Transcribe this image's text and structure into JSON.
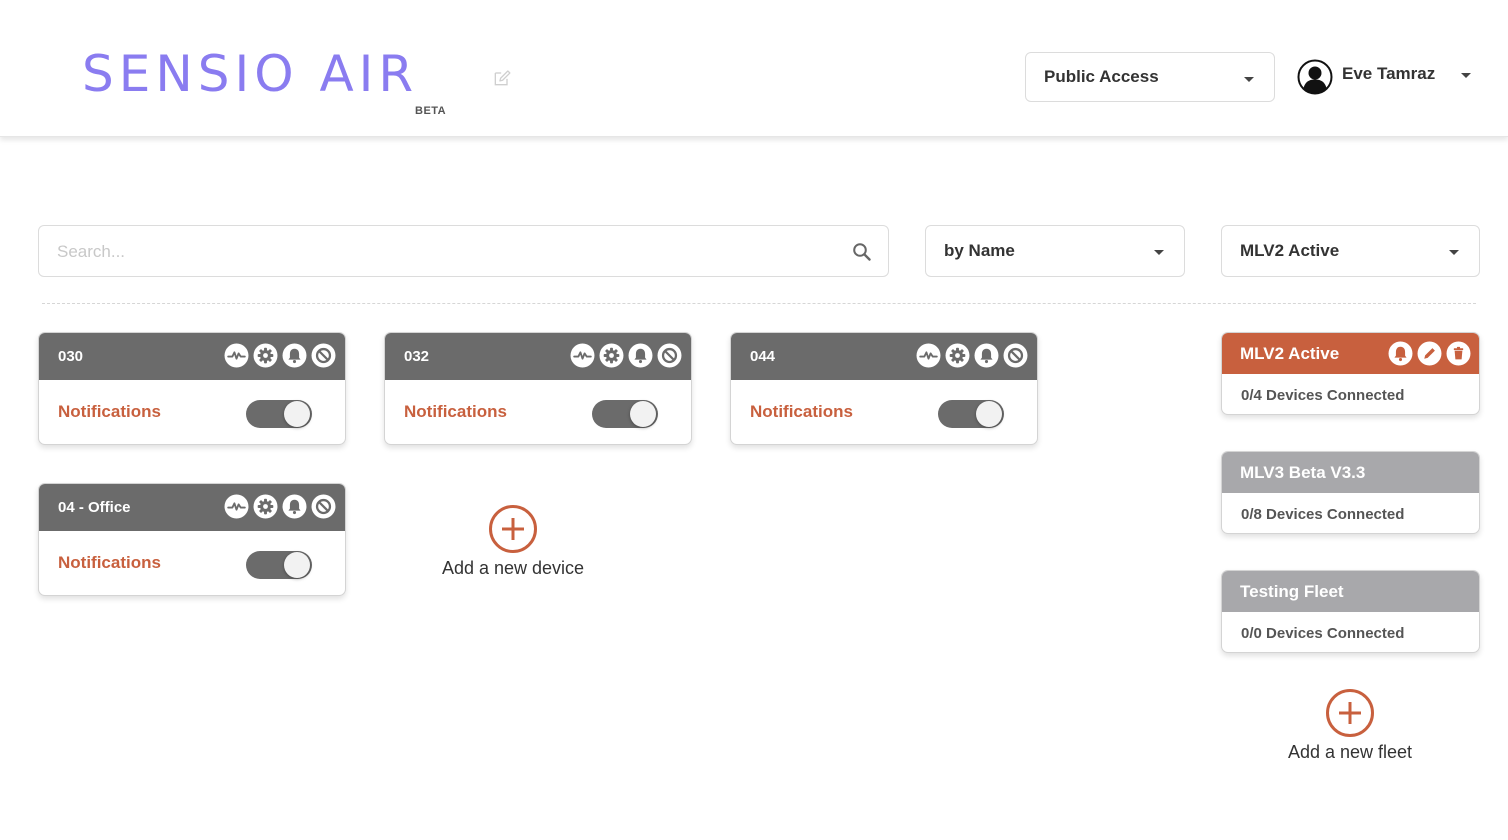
{
  "header": {
    "logo_text": "SENSIO AIR",
    "beta_label": "BETA",
    "access_select": {
      "value": "Public Access"
    },
    "user": {
      "name": "Eve Tamraz"
    }
  },
  "filters": {
    "search_placeholder": "Search...",
    "sort_select": {
      "value": "by Name"
    },
    "fleet_select": {
      "value": "MLV2 Active"
    }
  },
  "devices": [
    {
      "name": "030",
      "notifications_label": "Notifications",
      "notifications_on": true
    },
    {
      "name": "032",
      "notifications_label": "Notifications",
      "notifications_on": true
    },
    {
      "name": "044",
      "notifications_label": "Notifications",
      "notifications_on": true
    },
    {
      "name": "04 - Office",
      "notifications_label": "Notifications",
      "notifications_on": true
    }
  ],
  "device_icons": [
    "chart-icon",
    "gear-icon",
    "bell-icon",
    "block-icon"
  ],
  "add_device_label": "Add a new device",
  "fleets": [
    {
      "name": "MLV2 Active",
      "status": "0/4 Devices Connected",
      "active": true
    },
    {
      "name": "MLV3 Beta V3.3",
      "status": "0/8 Devices Connected",
      "active": false
    },
    {
      "name": "Testing Fleet",
      "status": "0/0 Devices Connected",
      "active": false
    }
  ],
  "fleet_icons": [
    "bell-icon",
    "pencil-icon",
    "trash-icon"
  ],
  "add_fleet_label": "Add a new fleet",
  "colors": {
    "logo": "#8a7cf0",
    "accent": "#c8603e",
    "card_header": "#6b6b6b",
    "fleet_inactive": "#a8a8ab"
  }
}
